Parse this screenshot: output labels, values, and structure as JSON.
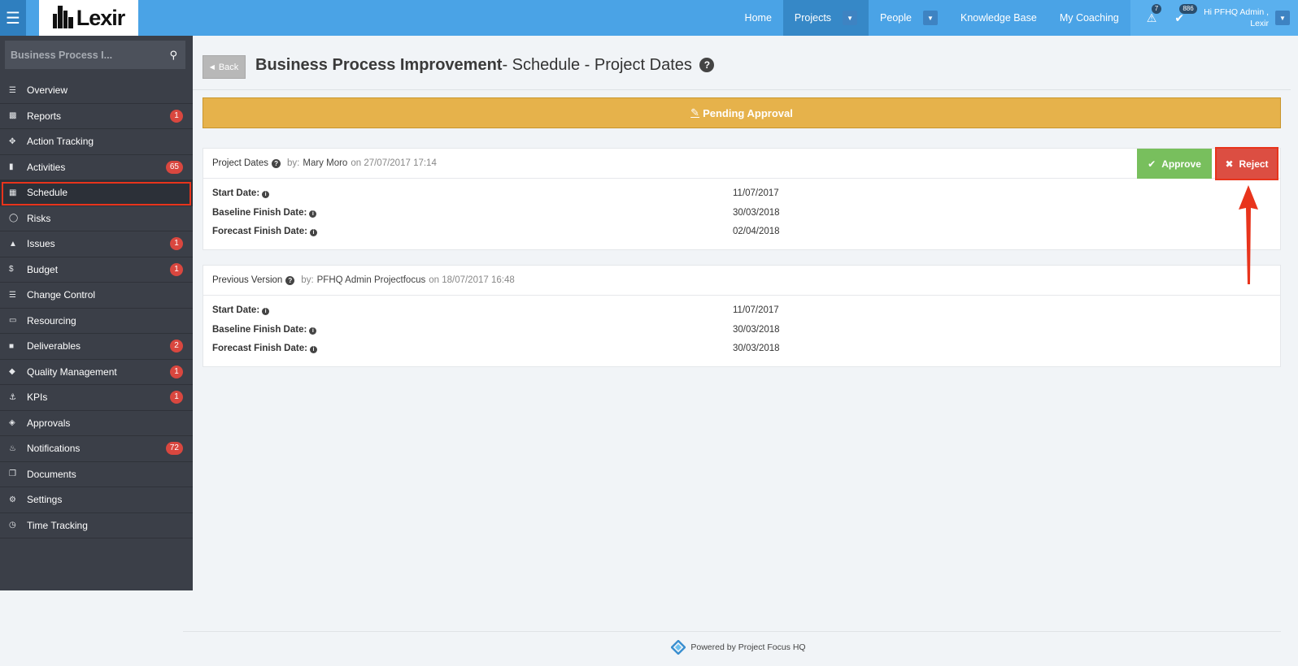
{
  "app": {
    "logo_text": "Lexir"
  },
  "nav": {
    "home": "Home",
    "projects": "Projects",
    "people": "People",
    "knowledge_base": "Knowledge Base",
    "my_coaching": "My Coaching",
    "alerts_count": "7",
    "tasks_count": "886",
    "user_line1": "Hi PFHQ Admin ,",
    "user_line2": "Lexir"
  },
  "sidebar": {
    "search_text": "Business Process I...",
    "items": [
      {
        "label": "Overview",
        "icon": "list-icon",
        "badge": ""
      },
      {
        "label": "Reports",
        "icon": "bar-chart-icon",
        "badge": "1"
      },
      {
        "label": "Action Tracking",
        "icon": "crosshair-icon",
        "badge": ""
      },
      {
        "label": "Activities",
        "icon": "bookmark-icon",
        "badge": "65"
      },
      {
        "label": "Schedule",
        "icon": "calendar-icon",
        "badge": ""
      },
      {
        "label": "Risks",
        "icon": "lightbulb-icon",
        "badge": ""
      },
      {
        "label": "Issues",
        "icon": "warning-icon",
        "badge": "1"
      },
      {
        "label": "Budget",
        "icon": "dollar-icon",
        "badge": "1"
      },
      {
        "label": "Change Control",
        "icon": "layers-icon",
        "badge": ""
      },
      {
        "label": "Resourcing",
        "icon": "folder-open-icon",
        "badge": ""
      },
      {
        "label": "Deliverables",
        "icon": "truck-icon",
        "badge": "2"
      },
      {
        "label": "Quality Management",
        "icon": "tag-icon",
        "badge": "1"
      },
      {
        "label": "KPIs",
        "icon": "anchor-icon",
        "badge": "1"
      },
      {
        "label": "Approvals",
        "icon": "ticket-icon",
        "badge": ""
      },
      {
        "label": "Notifications",
        "icon": "bell-icon",
        "badge": "72"
      },
      {
        "label": "Documents",
        "icon": "copy-icon",
        "badge": ""
      },
      {
        "label": "Settings",
        "icon": "gears-icon",
        "badge": ""
      },
      {
        "label": "Time Tracking",
        "icon": "clock-icon",
        "badge": ""
      }
    ]
  },
  "page": {
    "back_label": "Back",
    "title_bold": "Business Process Improvement",
    "title_rest": "- Schedule - Project Dates",
    "pending_label": "Pending Approval",
    "approve_label": "Approve",
    "reject_label": "Reject"
  },
  "current": {
    "title": "Project Dates",
    "by": "by:",
    "author": "Mary Moro",
    "on": "on 27/07/2017 17:14",
    "rows": [
      {
        "label": "Start Date:",
        "value": "11/07/2017"
      },
      {
        "label": "Baseline Finish Date:",
        "value": "30/03/2018"
      },
      {
        "label": "Forecast Finish Date:",
        "value": "02/04/2018"
      }
    ]
  },
  "previous": {
    "title": "Previous Version",
    "by": "by:",
    "author": "PFHQ Admin Projectfocus",
    "on": "on 18/07/2017 16:48",
    "rows": [
      {
        "label": "Start Date:",
        "value": "11/07/2017"
      },
      {
        "label": "Baseline Finish Date:",
        "value": "30/03/2018"
      },
      {
        "label": "Forecast Finish Date:",
        "value": "30/03/2018"
      }
    ]
  },
  "footer": {
    "text": "Powered by Project Focus HQ"
  },
  "colors": {
    "topbar": "#4aa3e6",
    "sidebar": "#3b3f48",
    "pending": "#e6b24b",
    "approve": "#78bf5d",
    "reject": "#dc4e42",
    "highlight": "#e8341c"
  }
}
